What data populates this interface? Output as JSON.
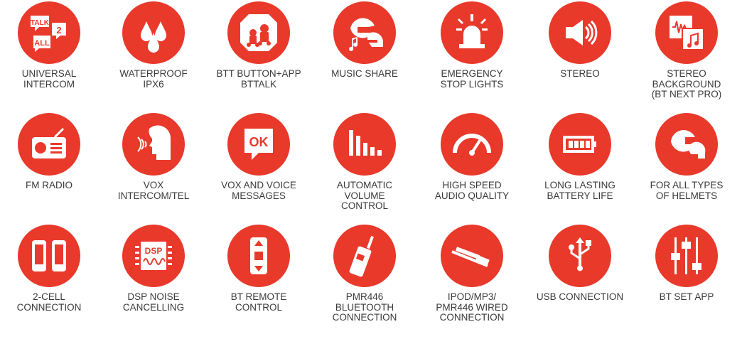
{
  "colors": {
    "accent": "#e8392b",
    "icon": "#ffffff",
    "text": "#3a3a3a"
  },
  "features": [
    {
      "icon": "talk-all-speech-bubbles-icon",
      "lines": [
        "UNIVERSAL",
        "INTERCOM"
      ],
      "glyphs": [
        "TALK",
        "2",
        "ALL"
      ]
    },
    {
      "icon": "water-drops-icon",
      "lines": [
        "WATERPROOF",
        "IPX6"
      ]
    },
    {
      "icon": "riders-app-icon",
      "lines": [
        "BTT BUTTON+APP",
        "BTTALK"
      ]
    },
    {
      "icon": "helmets-music-icon",
      "lines": [
        "MUSIC SHARE"
      ]
    },
    {
      "icon": "emergency-light-icon",
      "lines": [
        "EMERGENCY",
        "STOP LIGHTS"
      ]
    },
    {
      "icon": "speaker-icon",
      "lines": [
        "STEREO"
      ]
    },
    {
      "icon": "stereo-background-icon",
      "lines": [
        "STEREO",
        "BACKGROUND",
        "(BT NEXT PRO)"
      ]
    },
    {
      "icon": "radio-icon",
      "lines": [
        "FM RADIO"
      ]
    },
    {
      "icon": "voice-head-icon",
      "lines": [
        "VOX",
        "INTERCOM/TEL"
      ]
    },
    {
      "icon": "ok-speech-bubble-icon",
      "lines": [
        "VOX AND VOICE",
        "MESSAGES"
      ],
      "glyphs": [
        "OK"
      ]
    },
    {
      "icon": "volume-bars-icon",
      "lines": [
        "AUTOMATIC",
        "VOLUME",
        "CONTROL"
      ]
    },
    {
      "icon": "speedometer-icon",
      "lines": [
        "HIGH SPEED",
        "AUDIO QUALITY"
      ]
    },
    {
      "icon": "battery-icon",
      "lines": [
        "LONG LASTING",
        "BATTERY LIFE"
      ]
    },
    {
      "icon": "helmets-icon",
      "lines": [
        "FOR ALL TYPES",
        "OF HELMETS"
      ]
    },
    {
      "icon": "phones-icon",
      "lines": [
        "2-CELL",
        "CONNECTION"
      ]
    },
    {
      "icon": "dsp-chip-icon",
      "lines": [
        "DSP NOISE",
        "CANCELLING"
      ],
      "glyphs": [
        "DSP"
      ]
    },
    {
      "icon": "remote-control-icon",
      "lines": [
        "BT REMOTE",
        "CONTROL"
      ]
    },
    {
      "icon": "walkie-talkie-icon",
      "lines": [
        "PMR446",
        "BLUETOOTH",
        "CONNECTION"
      ]
    },
    {
      "icon": "audio-jack-icon",
      "lines": [
        "IPOD/MP3/",
        "PMR446 WIRED",
        "CONNECTION"
      ]
    },
    {
      "icon": "usb-icon",
      "lines": [
        "USB CONNECTION"
      ]
    },
    {
      "icon": "sliders-icon",
      "lines": [
        "BT SET APP"
      ]
    }
  ]
}
